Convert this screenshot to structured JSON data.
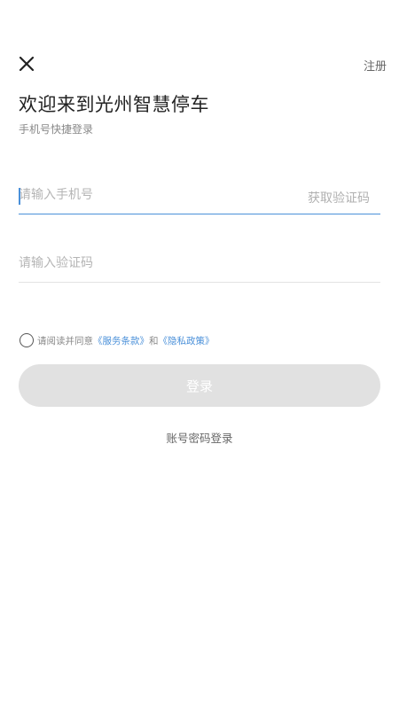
{
  "header": {
    "close_icon": "close-icon",
    "register_label": "注册"
  },
  "main": {
    "title": "欢迎来到光州智慧停车",
    "subtitle": "手机号快捷登录"
  },
  "form": {
    "phone": {
      "placeholder": "请输入手机号",
      "value": ""
    },
    "get_code_label": "获取验证码",
    "code": {
      "placeholder": "请输入验证码",
      "value": ""
    },
    "agreement": {
      "prefix": "请阅读并同意",
      "terms_link": "《服务条款》",
      "and": "和",
      "privacy_link": "《隐私政策》",
      "checked": false
    },
    "login_label": "登录",
    "alt_login_label": "账号密码登录"
  },
  "colors": {
    "accent": "#4a90d9",
    "button_disabled": "#e1e1e1",
    "placeholder": "#b5b5b5"
  }
}
